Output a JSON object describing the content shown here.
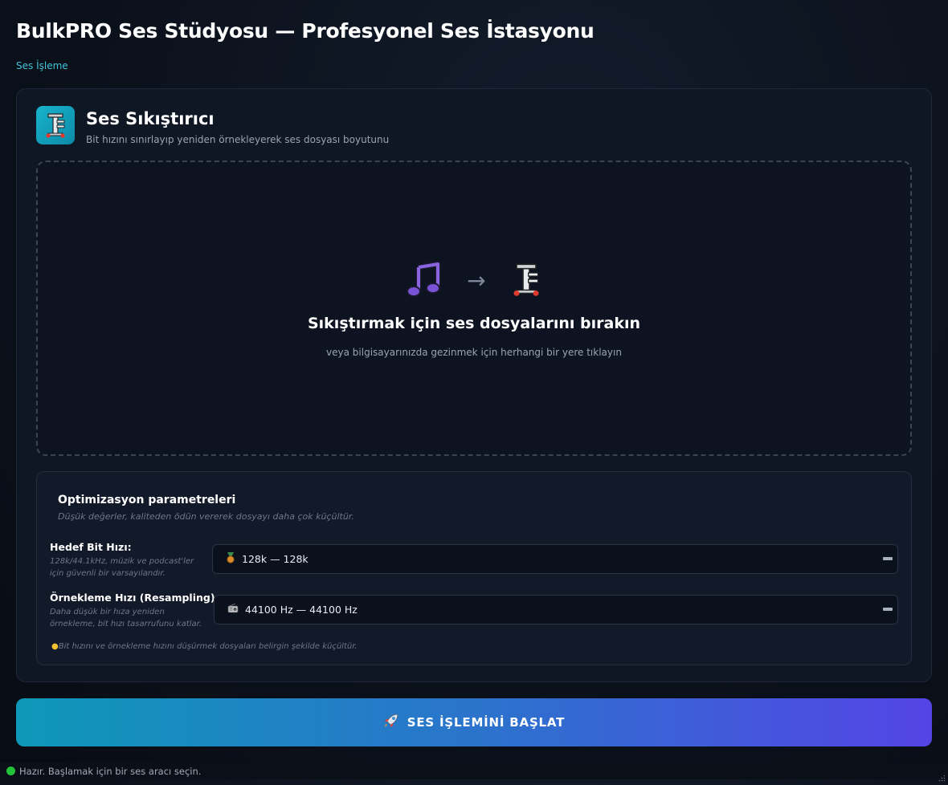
{
  "app": {
    "title": "BulkPRO Ses Stüdyosu — Profesyonel Ses İstasyonu",
    "breadcrumb": "Ses İşleme"
  },
  "tool": {
    "icon": "clamp-icon",
    "title": "Ses Sıkıştırıcı",
    "subtitle": "Bit hızını sınırlayıp yeniden örnekleyerek ses dosyası boyutunu"
  },
  "dropzone": {
    "source_icon": "music-note-icon",
    "arrow": "→",
    "target_icon": "clamp-icon",
    "title": "Sıkıştırmak için ses dosyalarını bırakın",
    "subtitle": "veya bilgisayarınızda gezinmek için herhangi bir yere tıklayın"
  },
  "params": {
    "title": "Optimizasyon parametreleri",
    "description": "Düşük değerler, kaliteden ödün vererek dosyayı daha çok küçültür.",
    "bitrate": {
      "label": "Hedef Bit Hızı:",
      "hint": "128k/44.1kHz, müzik ve podcast'ler için güvenli bir varsayılandır.",
      "icon": "medal-icon",
      "value": "128k — 128k"
    },
    "samplerate": {
      "label": "Örnekleme Hızı (Resampling):",
      "hint": "Daha düşük bir hıza yeniden örnekleme, bit hızı tasarrufunu katlar.",
      "icon": "radio-icon",
      "value": "44100 Hz — 44100 Hz"
    },
    "tip_icon": "lightbulb-icon",
    "tip": "Bit hızını ve örnekleme hızını düşürmek dosyaları belirgin şekilde küçültür."
  },
  "action": {
    "icon": "rocket-icon",
    "label": "SES İŞLEMİNİ BAŞLAT"
  },
  "status": {
    "color": "#22c33a",
    "text": "Hazır. Başlamak için bir ses aracı seçin."
  }
}
